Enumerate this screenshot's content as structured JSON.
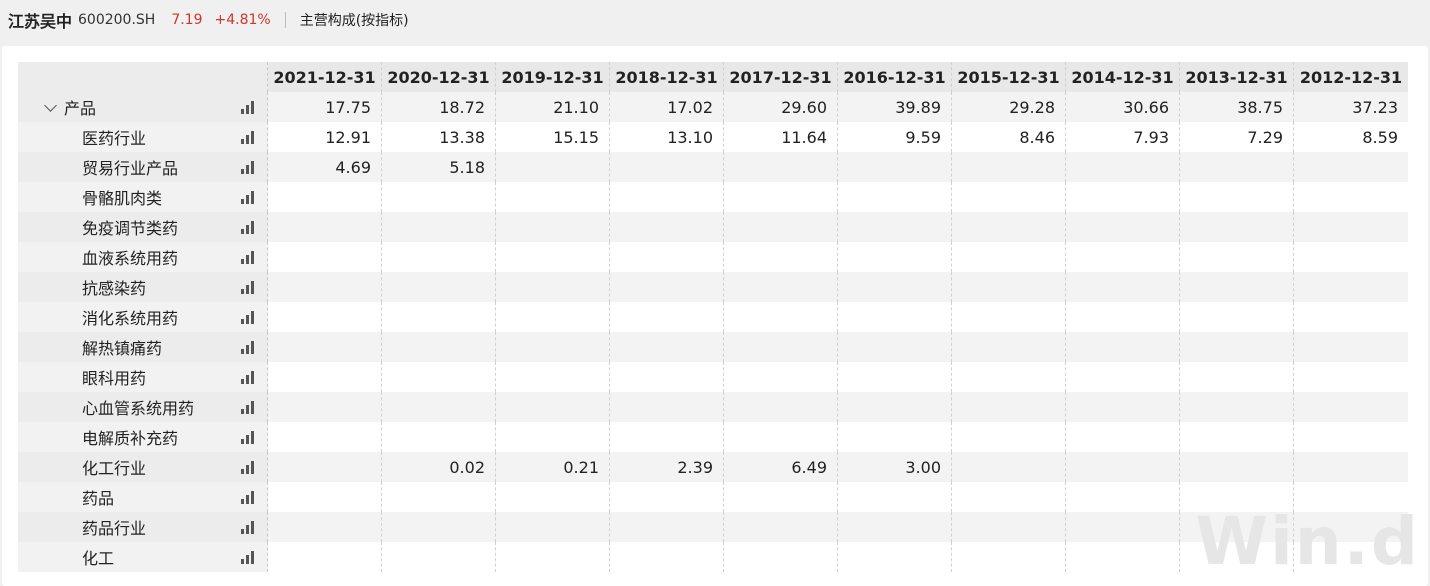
{
  "header": {
    "stock_name": "江苏吴中",
    "stock_code": "600200.SH",
    "price": "7.19",
    "change": "+4.81%",
    "section": "主营构成(按指标)"
  },
  "table": {
    "columns": [
      "2021-12-31",
      "2020-12-31",
      "2019-12-31",
      "2018-12-31",
      "2017-12-31",
      "2016-12-31",
      "2015-12-31",
      "2014-12-31",
      "2013-12-31",
      "2012-12-31"
    ],
    "rows": [
      {
        "label": "产品",
        "top": true,
        "values": [
          "17.75",
          "18.72",
          "21.10",
          "17.02",
          "29.60",
          "39.89",
          "29.28",
          "30.66",
          "38.75",
          "37.23"
        ]
      },
      {
        "label": "医药行业",
        "values": [
          "12.91",
          "13.38",
          "15.15",
          "13.10",
          "11.64",
          "9.59",
          "8.46",
          "7.93",
          "7.29",
          "8.59"
        ]
      },
      {
        "label": "贸易行业产品",
        "values": [
          "4.69",
          "5.18",
          "",
          "",
          "",
          "",
          "",
          "",
          "",
          ""
        ]
      },
      {
        "label": "骨骼肌肉类",
        "values": [
          "",
          "",
          "",
          "",
          "",
          "",
          "",
          "",
          "",
          ""
        ]
      },
      {
        "label": "免疫调节类药",
        "values": [
          "",
          "",
          "",
          "",
          "",
          "",
          "",
          "",
          "",
          ""
        ]
      },
      {
        "label": "血液系统用药",
        "values": [
          "",
          "",
          "",
          "",
          "",
          "",
          "",
          "",
          "",
          ""
        ]
      },
      {
        "label": "抗感染药",
        "values": [
          "",
          "",
          "",
          "",
          "",
          "",
          "",
          "",
          "",
          ""
        ]
      },
      {
        "label": "消化系统用药",
        "values": [
          "",
          "",
          "",
          "",
          "",
          "",
          "",
          "",
          "",
          ""
        ]
      },
      {
        "label": "解热镇痛药",
        "values": [
          "",
          "",
          "",
          "",
          "",
          "",
          "",
          "",
          "",
          ""
        ]
      },
      {
        "label": "眼科用药",
        "values": [
          "",
          "",
          "",
          "",
          "",
          "",
          "",
          "",
          "",
          ""
        ]
      },
      {
        "label": "心血管系统用药",
        "values": [
          "",
          "",
          "",
          "",
          "",
          "",
          "",
          "",
          "",
          ""
        ]
      },
      {
        "label": "电解质补充药",
        "values": [
          "",
          "",
          "",
          "",
          "",
          "",
          "",
          "",
          "",
          ""
        ]
      },
      {
        "label": "化工行业",
        "values": [
          "",
          "0.02",
          "0.21",
          "2.39",
          "6.49",
          "3.00",
          "",
          "",
          "",
          ""
        ]
      },
      {
        "label": "药品",
        "values": [
          "",
          "",
          "",
          "",
          "",
          "",
          "",
          "",
          "",
          ""
        ]
      },
      {
        "label": "药品行业",
        "values": [
          "",
          "",
          "",
          "",
          "",
          "",
          "",
          "",
          "",
          ""
        ]
      },
      {
        "label": "化工",
        "values": [
          "",
          "",
          "",
          "",
          "",
          "",
          "",
          "",
          "",
          ""
        ]
      }
    ]
  },
  "icons": {
    "expand": "chevron-down-icon",
    "chart": "bar-chart-icon"
  },
  "watermark": "Win.d"
}
